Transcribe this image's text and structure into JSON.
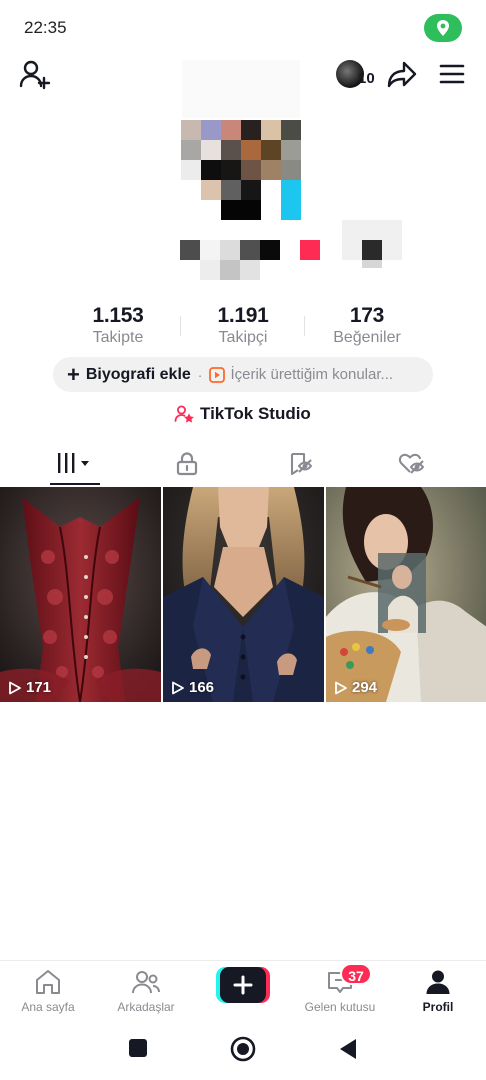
{
  "status_bar": {
    "time": "22:35",
    "location_pill_color": "#2fbe5c"
  },
  "header": {
    "follower_notification_count": "10"
  },
  "stats": [
    {
      "value": "1.153",
      "label": "Takipte"
    },
    {
      "value": "1.191",
      "label": "Takipçi"
    },
    {
      "value": "173",
      "label": "Beğeniler"
    }
  ],
  "bio": {
    "add_label": "Biyografi ekle",
    "separator": "·",
    "suggestion": "İçerik ürettiğim konular..."
  },
  "studio": {
    "label": "TikTok Studio"
  },
  "tabs": [
    {
      "icon": "videos-grid-icon",
      "active": true
    },
    {
      "icon": "lock-icon",
      "active": false
    },
    {
      "icon": "favorites-icon",
      "active": false
    },
    {
      "icon": "liked-icon",
      "active": false
    }
  ],
  "videos": [
    {
      "views": "171",
      "subject": "red corset"
    },
    {
      "views": "166",
      "subject": "woman in navy blazer"
    },
    {
      "views": "294",
      "subject": "woman painting"
    }
  ],
  "bottom_nav": {
    "home": "Ana sayfa",
    "friends": "Arkadaşlar",
    "inbox": "Gelen kutusu",
    "inbox_badge": "37",
    "profile": "Profil"
  },
  "colors": {
    "accent": "#fe2c55",
    "cyan": "#25f4ee",
    "text": "#161823",
    "muted": "#8a8b91"
  }
}
